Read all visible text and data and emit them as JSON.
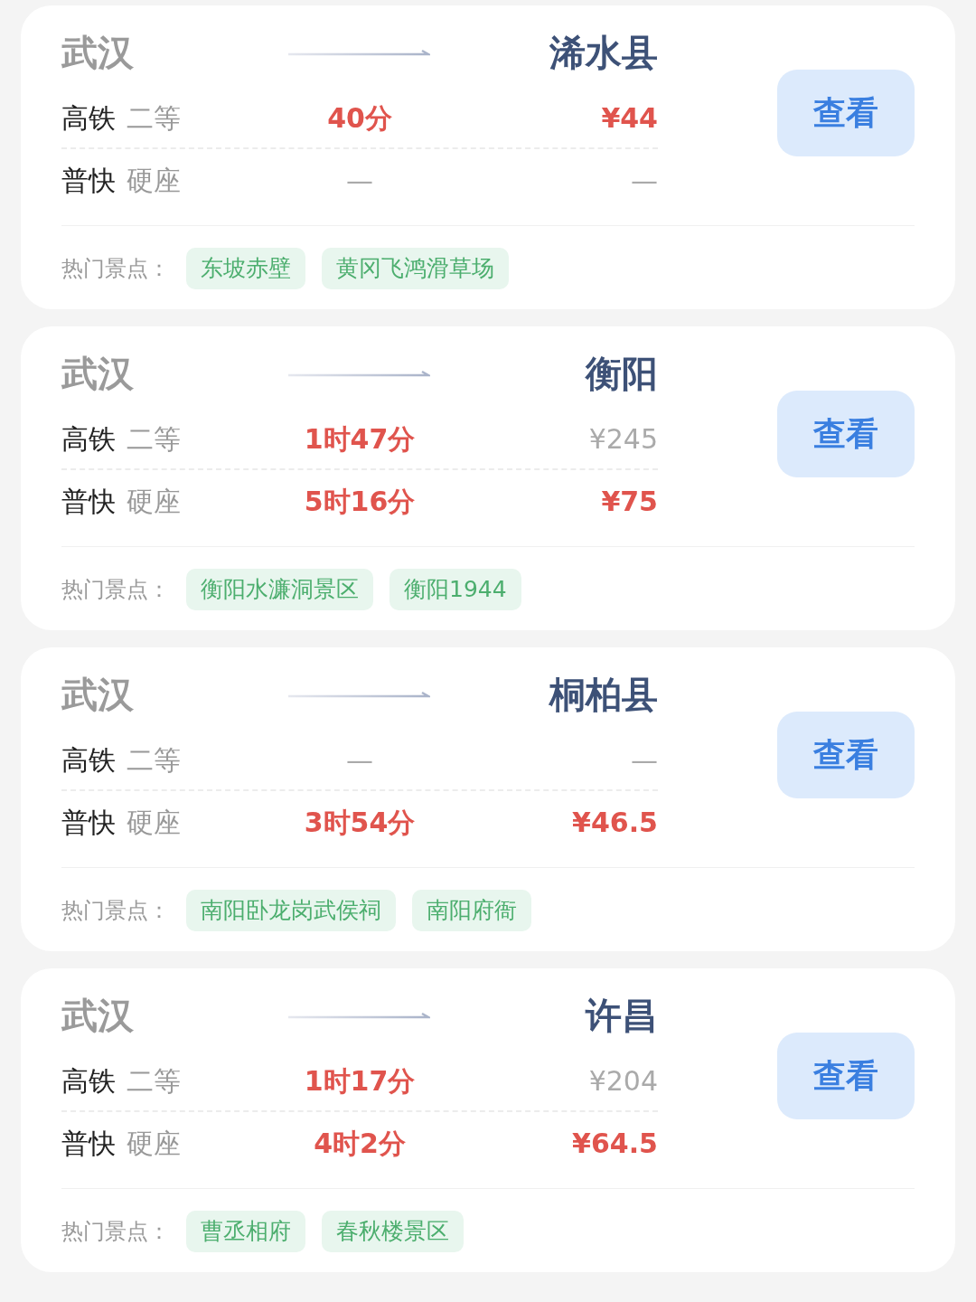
{
  "routes": [
    {
      "origin": "武汉",
      "destination": "浠水县",
      "trains": [
        {
          "type": "高铁",
          "seat": "二等",
          "duration": {
            "text": "40分",
            "highlight": true
          },
          "price": {
            "text": "¥44",
            "highlight": true
          }
        },
        {
          "type": "普快",
          "seat": "硬座",
          "duration": {
            "text": "—",
            "highlight": false
          },
          "price": {
            "text": "—",
            "highlight": false
          }
        }
      ],
      "button": "查看",
      "attractions_label": "热门景点：",
      "attractions": [
        "东坡赤壁",
        "黄冈飞鸿滑草场"
      ]
    },
    {
      "origin": "武汉",
      "destination": "衡阳",
      "trains": [
        {
          "type": "高铁",
          "seat": "二等",
          "duration": {
            "text": "1时47分",
            "highlight": true
          },
          "price": {
            "text": "¥245",
            "highlight": false
          }
        },
        {
          "type": "普快",
          "seat": "硬座",
          "duration": {
            "text": "5时16分",
            "highlight": true
          },
          "price": {
            "text": "¥75",
            "highlight": true
          }
        }
      ],
      "button": "查看",
      "attractions_label": "热门景点：",
      "attractions": [
        "衡阳水濂洞景区",
        "衡阳1944"
      ]
    },
    {
      "origin": "武汉",
      "destination": "桐柏县",
      "trains": [
        {
          "type": "高铁",
          "seat": "二等",
          "duration": {
            "text": "—",
            "highlight": false
          },
          "price": {
            "text": "—",
            "highlight": false
          }
        },
        {
          "type": "普快",
          "seat": "硬座",
          "duration": {
            "text": "3时54分",
            "highlight": true
          },
          "price": {
            "text": "¥46.5",
            "highlight": true
          }
        }
      ],
      "button": "查看",
      "attractions_label": "热门景点：",
      "attractions": [
        "南阳卧龙岗武侯祠",
        "南阳府衙"
      ]
    },
    {
      "origin": "武汉",
      "destination": "许昌",
      "trains": [
        {
          "type": "高铁",
          "seat": "二等",
          "duration": {
            "text": "1时17分",
            "highlight": true
          },
          "price": {
            "text": "¥204",
            "highlight": false
          }
        },
        {
          "type": "普快",
          "seat": "硬座",
          "duration": {
            "text": "4时2分",
            "highlight": true
          },
          "price": {
            "text": "¥64.5",
            "highlight": true
          }
        }
      ],
      "button": "查看",
      "attractions_label": "热门景点：",
      "attractions": [
        "曹丞相府",
        "春秋楼景区"
      ]
    }
  ]
}
